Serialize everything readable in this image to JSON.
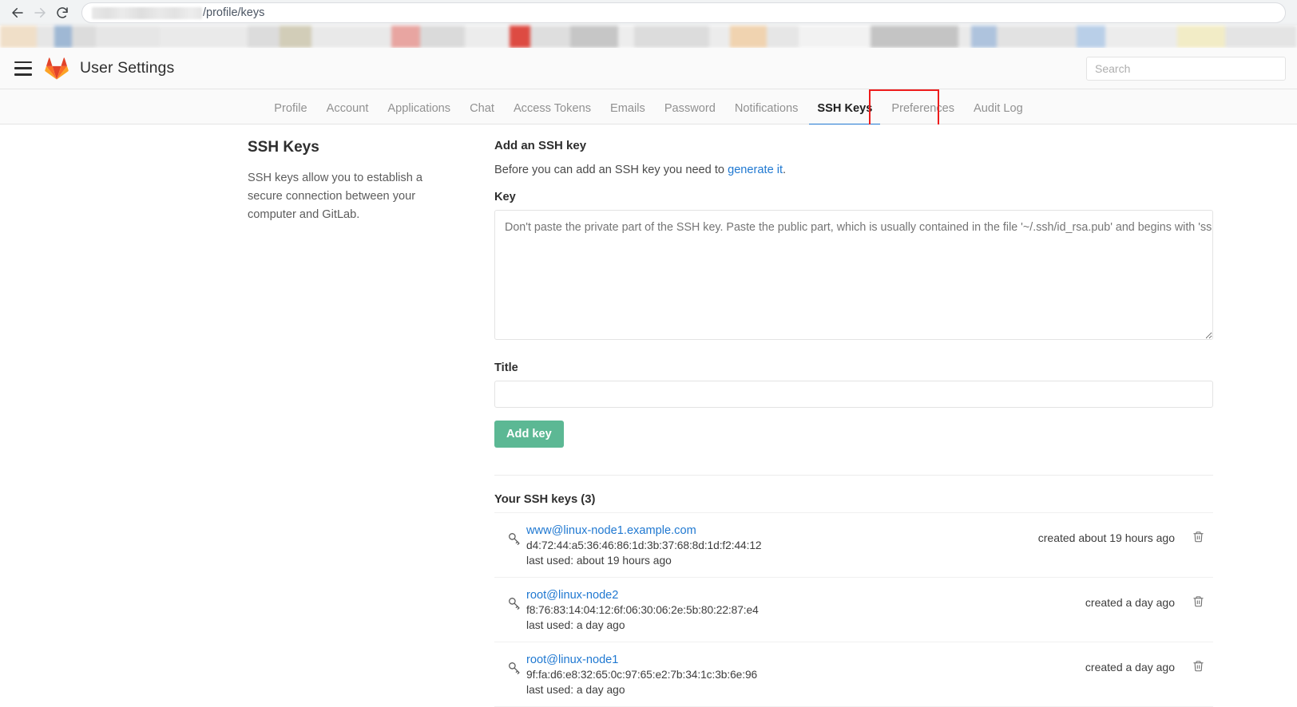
{
  "browser": {
    "back_icon": "arrow-left-icon",
    "forward_icon": "arrow-right-icon",
    "reload_icon": "reload-icon",
    "url_redacted": "",
    "url_path": "/profile/keys",
    "bookmarks_blurred": true
  },
  "header": {
    "menu_icon": "hamburger-icon",
    "logo_icon": "gitlab-logo-icon",
    "title": "User Settings",
    "search_placeholder": "Search"
  },
  "nav": {
    "tabs": [
      {
        "label": "Profile",
        "active": false
      },
      {
        "label": "Account",
        "active": false
      },
      {
        "label": "Applications",
        "active": false
      },
      {
        "label": "Chat",
        "active": false
      },
      {
        "label": "Access Tokens",
        "active": false
      },
      {
        "label": "Emails",
        "active": false
      },
      {
        "label": "Password",
        "active": false
      },
      {
        "label": "Notifications",
        "active": false
      },
      {
        "label": "SSH Keys",
        "active": true
      },
      {
        "label": "Preferences",
        "active": false
      },
      {
        "label": "Audit Log",
        "active": false
      }
    ],
    "annotation_color": "#ee1c1c",
    "active_underline_color": "#1f78d1"
  },
  "sidebar": {
    "title": "SSH Keys",
    "description": "SSH keys allow you to establish a secure connection between your computer and GitLab."
  },
  "main": {
    "section_title": "Add an SSH key",
    "section_subtitle_prefix": "Before you can add an SSH key you need to ",
    "section_subtitle_link": "generate it",
    "section_subtitle_suffix": ".",
    "key_label": "Key",
    "key_placeholder": "Don't paste the private part of the SSH key. Paste the public part, which is usually contained in the file '~/.ssh/id_rsa.pub' and begins with 'ssh-rsa'.",
    "key_value": "",
    "title_label": "Title",
    "title_value": "",
    "title_placeholder": "",
    "add_key_label": "Add key",
    "add_key_color": "#5cb894"
  },
  "keys_section": {
    "heading": "Your SSH keys (3)",
    "key_icon": "key-icon",
    "delete_icon": "trash-icon",
    "keys": [
      {
        "name": "www@linux-node1.example.com",
        "fingerprint": "d4:72:44:a5:36:46:86:1d:3b:37:68:8d:1d:f2:44:12",
        "last_used": "last used: about 19 hours ago",
        "created": "created about 19 hours ago"
      },
      {
        "name": "root@linux-node2",
        "fingerprint": "f8:76:83:14:04:12:6f:06:30:06:2e:5b:80:22:87:e4",
        "last_used": "last used: a day ago",
        "created": "created a day ago"
      },
      {
        "name": "root@linux-node1",
        "fingerprint": "9f:fa:d6:e8:32:65:0c:97:65:e2:7b:34:1c:3b:6e:96",
        "last_used": "last used: a day ago",
        "created": "created a day ago"
      }
    ]
  }
}
